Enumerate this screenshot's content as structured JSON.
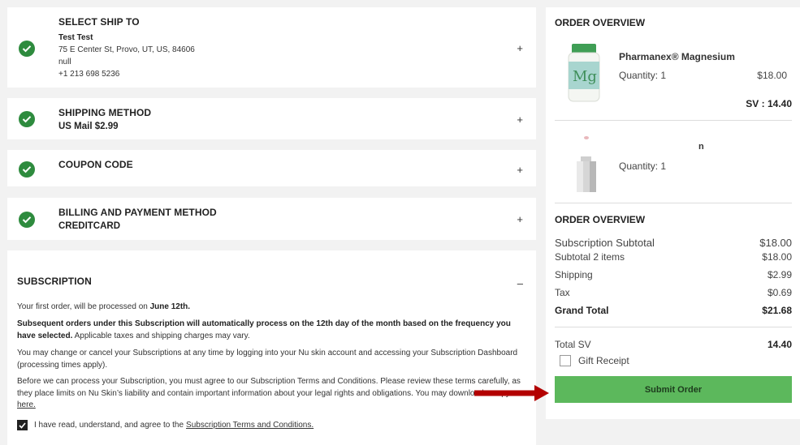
{
  "ship_to": {
    "title": "SELECT SHIP TO",
    "name": "Test Test",
    "address": "75 E Center St, Provo, UT, US, 84606",
    "line3": "null",
    "phone": "+1 213 698 5236",
    "expand": "+"
  },
  "shipping_method": {
    "title": "SHIPPING METHOD",
    "value": "US Mail $2.99",
    "expand": "+"
  },
  "coupon": {
    "title": "COUPON CODE",
    "expand": "+"
  },
  "billing": {
    "title": "BILLING AND PAYMENT METHOD",
    "value": "CREDITCARD",
    "expand": "+"
  },
  "subscription": {
    "title": "SUBSCRIPTION",
    "collapse": "–",
    "p1_a": "Your first order, will be processed on ",
    "p1_b": "June 12th.",
    "p2_a": "Subsequent orders under this Subscription will automatically process on the 12th day of the month based on the frequency you have selected.",
    "p2_b": " Applicable taxes and shipping charges may vary.",
    "p3": "You may change or cancel your Subscriptions at any time by logging into your Nu skin account and accessing your Subscription Dashboard (processing times apply).",
    "p4_a": "Before we can process your Subscription, you must agree to our Subscription Terms and Conditions. Please review these terms carefully, as they place limits on Nu Skin’s liability and contain important information about your legal rights and obligations. You may download a copy ",
    "p4_link": "here.",
    "agree_a": "I have read, understand, and agree to the ",
    "agree_link": "Subscription Terms and Conditions.",
    "agree_checked": true
  },
  "order_overview": {
    "title": "ORDER OVERVIEW",
    "items": [
      {
        "name": "Pharmanex® Magnesium",
        "quantity": "Quantity: 1",
        "price": "$18.00",
        "sv": "SV : 14.40",
        "image": "magnesium-bottle"
      },
      {
        "name": "n",
        "quantity": "Quantity: 1",
        "image": "silver-device"
      }
    ],
    "summary_title": "ORDER OVERVIEW",
    "rows": [
      {
        "label": "Subscription Subtotal",
        "value": "$18.00"
      },
      {
        "label": "Subtotal 2 items",
        "value": "$18.00"
      },
      {
        "label": "Shipping",
        "value": "$2.99"
      },
      {
        "label": "Tax",
        "value": "$0.69"
      },
      {
        "label": "Grand Total",
        "value": "$21.68"
      }
    ],
    "total_sv_label": "Total SV",
    "total_sv_value": "14.40",
    "gift_receipt": "Gift Receipt",
    "submit": "Submit Order",
    "bottle_label": "Mg"
  },
  "colors": {
    "check": "#2e8b3e",
    "submit": "#5cb85c",
    "arrow": "#b30000"
  }
}
